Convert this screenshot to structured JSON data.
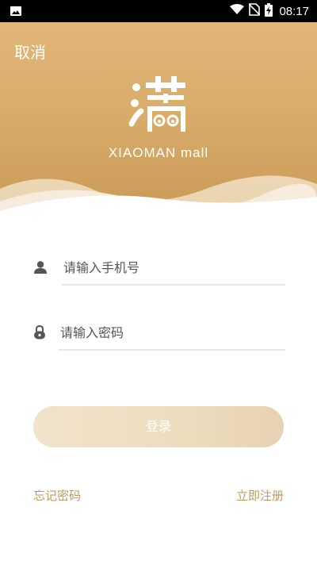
{
  "status_bar": {
    "time": "08:17"
  },
  "header": {
    "cancel_label": "取消",
    "brand_text": "XIAOMAN mall",
    "logo_icon": "xiaoman-logo-icon"
  },
  "form": {
    "phone": {
      "placeholder": "请输入手机号",
      "icon": "user-icon"
    },
    "password": {
      "placeholder": "请输入密码",
      "icon": "lock-icon"
    },
    "login_label": "登录"
  },
  "links": {
    "forgot_password": "忘记密码",
    "register": "立即注册"
  },
  "colors": {
    "brand_gold": "#d9ac6a",
    "link_gold": "#bf9a5f",
    "button_bg": "#eddcbe"
  }
}
